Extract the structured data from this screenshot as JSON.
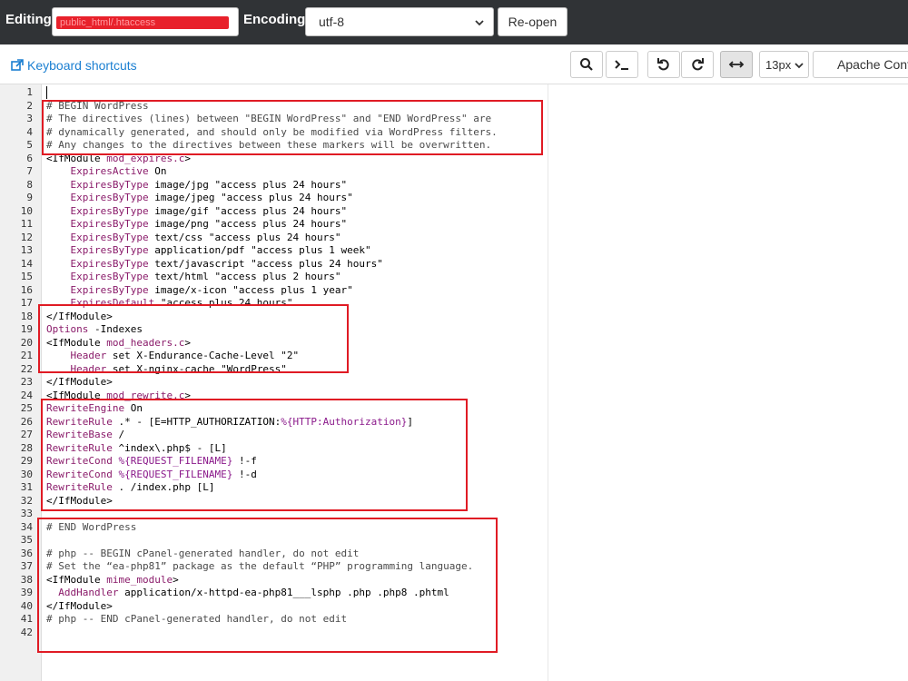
{
  "header": {
    "editing_label": "Editing:",
    "filename_redacted": "public_html/.htaccess",
    "encoding_label": "Encoding:",
    "encoding_value": "utf-8",
    "reopen_label": "Re-open"
  },
  "toolbar": {
    "keyboard_shortcuts": "Keyboard shortcuts",
    "font_size": "13px",
    "mode": "Apache Conf"
  },
  "colors": {
    "accent_link": "#1b7fd1",
    "highlight_box": "#e01b24",
    "topbar": "#303336"
  },
  "editor": {
    "lines": [
      {
        "n": "1",
        "t": ""
      },
      {
        "n": "2",
        "t": "# BEGIN WordPress"
      },
      {
        "n": "3",
        "t": "# The directives (lines) between \"BEGIN WordPress\" and \"END WordPress\" are"
      },
      {
        "n": "4",
        "t": "# dynamically generated, and should only be modified via WordPress filters."
      },
      {
        "n": "5",
        "t": "# Any changes to the directives between these markers will be overwritten."
      },
      {
        "n": "6",
        "t": "<IfModule mod_expires.c>"
      },
      {
        "n": "7",
        "t": "    ExpiresActive On"
      },
      {
        "n": "8",
        "t": "    ExpiresByType image/jpg \"access plus 24 hours\""
      },
      {
        "n": "9",
        "t": "    ExpiresByType image/jpeg \"access plus 24 hours\""
      },
      {
        "n": "10",
        "t": "    ExpiresByType image/gif \"access plus 24 hours\""
      },
      {
        "n": "11",
        "t": "    ExpiresByType image/png \"access plus 24 hours\""
      },
      {
        "n": "12",
        "t": "    ExpiresByType text/css \"access plus 24 hours\""
      },
      {
        "n": "13",
        "t": "    ExpiresByType application/pdf \"access plus 1 week\""
      },
      {
        "n": "14",
        "t": "    ExpiresByType text/javascript \"access plus 24 hours\""
      },
      {
        "n": "15",
        "t": "    ExpiresByType text/html \"access plus 2 hours\""
      },
      {
        "n": "16",
        "t": "    ExpiresByType image/x-icon \"access plus 1 year\""
      },
      {
        "n": "17",
        "t": "    ExpiresDefault \"access plus 24 hours\""
      },
      {
        "n": "18",
        "t": "</IfModule>"
      },
      {
        "n": "19",
        "t": "Options -Indexes"
      },
      {
        "n": "20",
        "t": "<IfModule mod_headers.c>"
      },
      {
        "n": "21",
        "t": "    Header set X-Endurance-Cache-Level \"2\""
      },
      {
        "n": "22",
        "t": "    Header set X-nginx-cache \"WordPress\""
      },
      {
        "n": "23",
        "t": "</IfModule>"
      },
      {
        "n": "24",
        "t": "<IfModule mod_rewrite.c>"
      },
      {
        "n": "25",
        "t": "RewriteEngine On"
      },
      {
        "n": "26",
        "t": "RewriteRule .* - [E=HTTP_AUTHORIZATION:%{HTTP:Authorization}]"
      },
      {
        "n": "27",
        "t": "RewriteBase /"
      },
      {
        "n": "28",
        "t": "RewriteRule ^index\\.php$ - [L]"
      },
      {
        "n": "29",
        "t": "RewriteCond %{REQUEST_FILENAME} !-f"
      },
      {
        "n": "30",
        "t": "RewriteCond %{REQUEST_FILENAME} !-d"
      },
      {
        "n": "31",
        "t": "RewriteRule . /index.php [L]"
      },
      {
        "n": "32",
        "t": "</IfModule>"
      },
      {
        "n": "33",
        "t": ""
      },
      {
        "n": "34",
        "t": "# END WordPress"
      },
      {
        "n": "35",
        "t": ""
      },
      {
        "n": "36",
        "t": "# php -- BEGIN cPanel-generated handler, do not edit"
      },
      {
        "n": "37",
        "t": "# Set the “ea-php81” package as the default “PHP” programming language."
      },
      {
        "n": "38",
        "t": "<IfModule mime_module>"
      },
      {
        "n": "39",
        "t": "  AddHandler application/x-httpd-ea-php81___lsphp .php .php8 .phtml"
      },
      {
        "n": "40",
        "t": "</IfModule>"
      },
      {
        "n": "41",
        "t": "# php -- END cPanel-generated handler, do not edit"
      },
      {
        "n": "42",
        "t": ""
      }
    ]
  }
}
